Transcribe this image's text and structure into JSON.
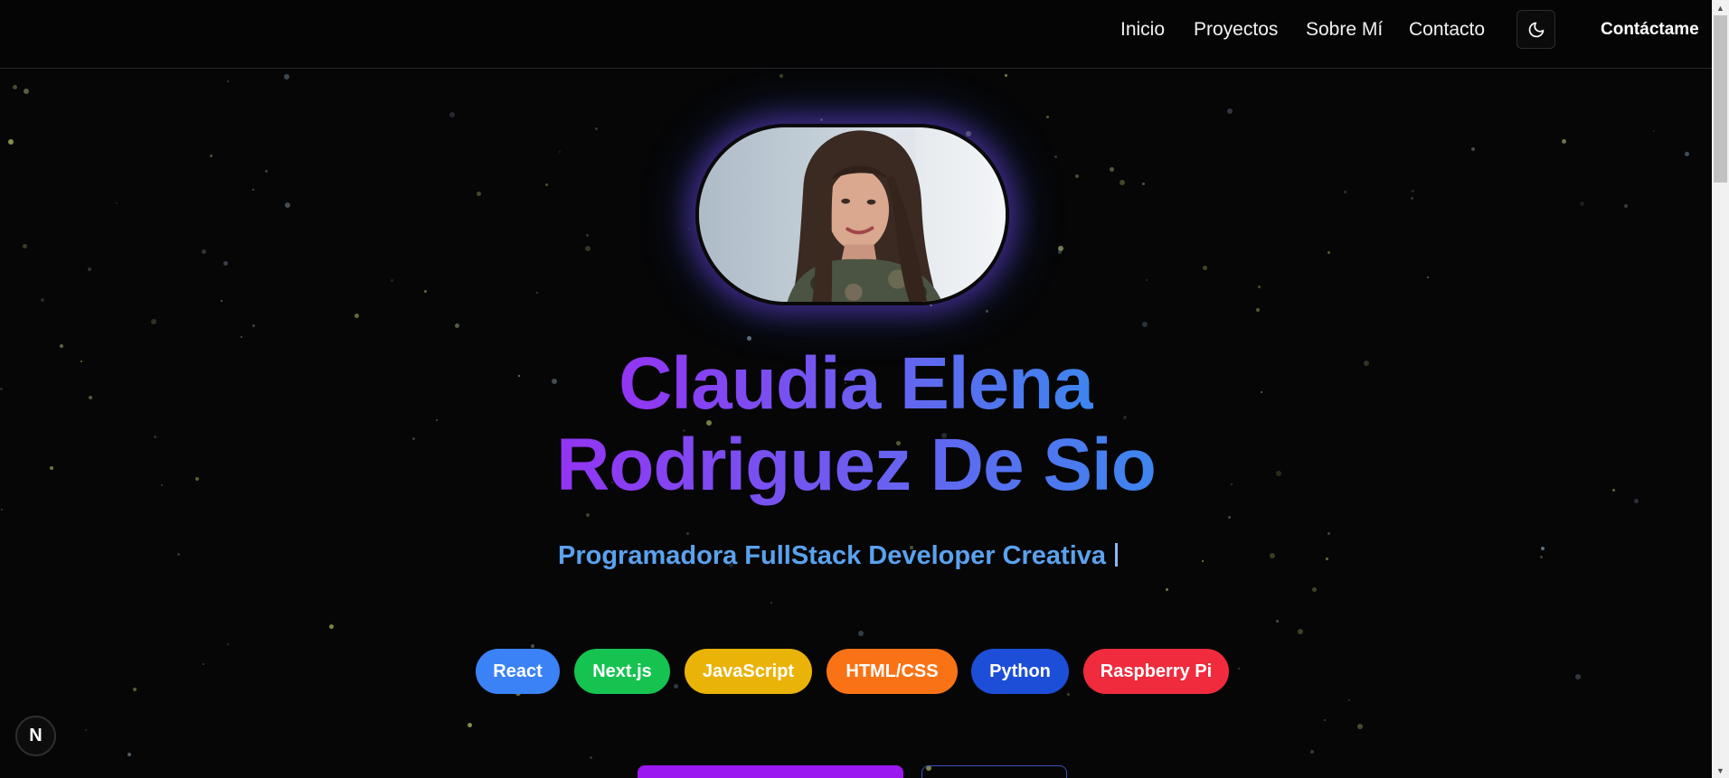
{
  "nav": {
    "links": [
      "Inicio",
      "Proyectos",
      "Sobre Mí",
      "Contacto"
    ],
    "theme_icon": "moon-icon",
    "cta": "Contáctame"
  },
  "hero": {
    "name_line1": "Claudia Elena",
    "name_line2": "Rodriguez De Sio",
    "subtitle": "Programadora FullStack Developer Creativa",
    "skills": [
      {
        "label": "React",
        "color": "#3b82f6"
      },
      {
        "label": "Next.js",
        "color": "#16c351"
      },
      {
        "label": "JavaScript",
        "color": "#eab308"
      },
      {
        "label": "HTML/CSS",
        "color": "#f97316"
      },
      {
        "label": "Python",
        "color": "#1d4ed8"
      },
      {
        "label": "Raspberry Pi",
        "color": "#ef2b3d"
      }
    ]
  },
  "dev_badge": "N",
  "colors": {
    "background": "#060607",
    "gradient_start": "#9334f3",
    "gradient_end": "#3d86ef",
    "subtitle": "#5aa2ee",
    "primary_button": "#9b18f0"
  }
}
